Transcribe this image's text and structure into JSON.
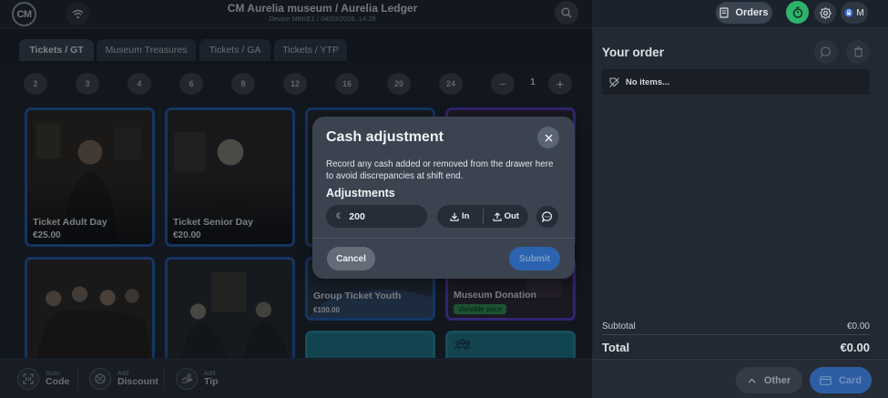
{
  "header": {
    "logo_text": "CM",
    "title": "CM Aurelia museum / Aurelia Ledger",
    "subtitle": "Device MBKE1 / 04/03/2026, 14:28",
    "orders_label": "Orders",
    "user_initial": "M"
  },
  "tabs": [
    {
      "label": "Tickets / GT",
      "active": true
    },
    {
      "label": "Museum Treasures",
      "active": false
    },
    {
      "label": "Tickets / GA",
      "active": false
    },
    {
      "label": "Tickets / YTP",
      "active": false
    }
  ],
  "quantity_presets": [
    "2",
    "3",
    "4",
    "6",
    "8",
    "12",
    "16",
    "20",
    "24"
  ],
  "quantity": {
    "minus": "−",
    "value": "1",
    "plus": "+"
  },
  "products": [
    {
      "name": "Ticket Adult Day",
      "price": "€25.00"
    },
    {
      "name": "Ticket Senior Day",
      "price": "€20.00"
    },
    {
      "name": "Group Ticket Youth",
      "price": "€100.00"
    },
    {
      "name": "Museum Donation",
      "badge": "Variable price"
    }
  ],
  "bottom_bar": {
    "scan": {
      "small": "Scan",
      "big": "Code"
    },
    "discount": {
      "small": "Add",
      "big": "Discount"
    },
    "tip": {
      "small": "Add",
      "big": "Tip"
    },
    "other_label": "Other",
    "card_label": "Card"
  },
  "order": {
    "title": "Your order",
    "empty_text": "No items...",
    "subtotal_label": "Subtotal",
    "subtotal_value": "€0.00",
    "total_label": "Total",
    "total_value": "€0.00"
  },
  "modal": {
    "title": "Cash adjustment",
    "description": "Record any cash added or removed from the drawer here to avoid discrepancies at shift end.",
    "adjustments_label": "Adjustments",
    "currency_symbol": "€",
    "amount": "200",
    "in_label": "In",
    "out_label": "Out",
    "cancel_label": "Cancel",
    "submit_label": "Submit"
  },
  "colors": {
    "accent_blue": "#2b63b0",
    "tile_border_blue": "#1e5cb0",
    "tile_border_purple": "#5a3ad0",
    "teal": "#1a7a8a",
    "timer_green": "#2db36b",
    "badge_green": "#2f9a55"
  }
}
